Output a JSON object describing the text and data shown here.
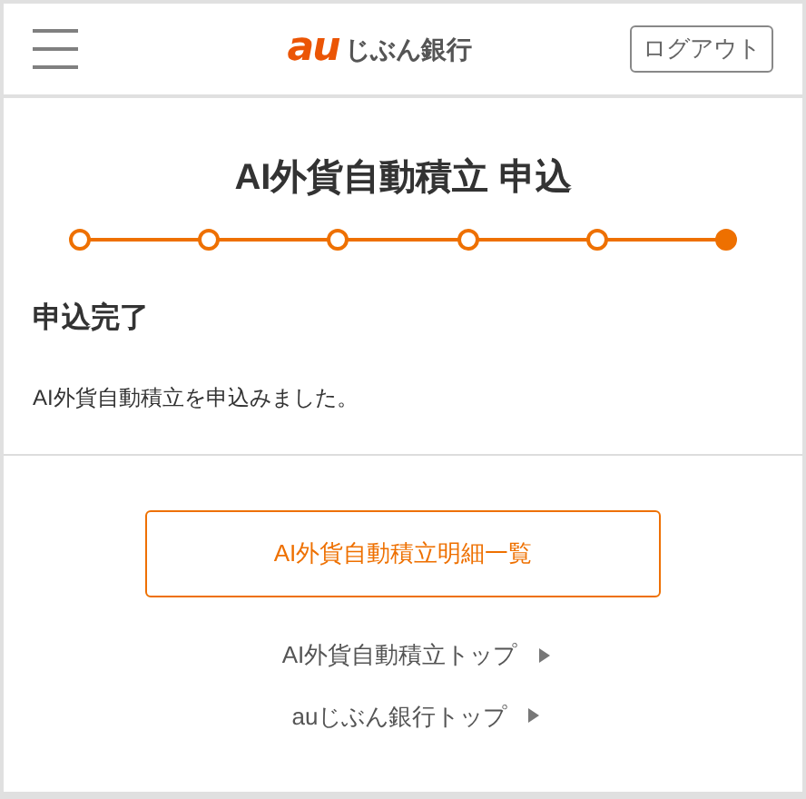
{
  "header": {
    "logo": {
      "brand": "au",
      "name": "じぶん銀行"
    },
    "logout_button": "ログアウト"
  },
  "title": "AI外貨自動積立 申込",
  "steps": [
    {
      "selected": false
    },
    {
      "selected": false
    },
    {
      "selected": false
    },
    {
      "selected": false
    },
    {
      "selected": false
    },
    {
      "selected": true
    }
  ],
  "section_heading": "申込完了",
  "message": "AI外貨自動積立を申込みました。",
  "primary_button": "AI外貨自動積立明細一覧",
  "links": [
    "AI外貨自動積立トップ",
    "auじぶん銀行トップ"
  ]
}
